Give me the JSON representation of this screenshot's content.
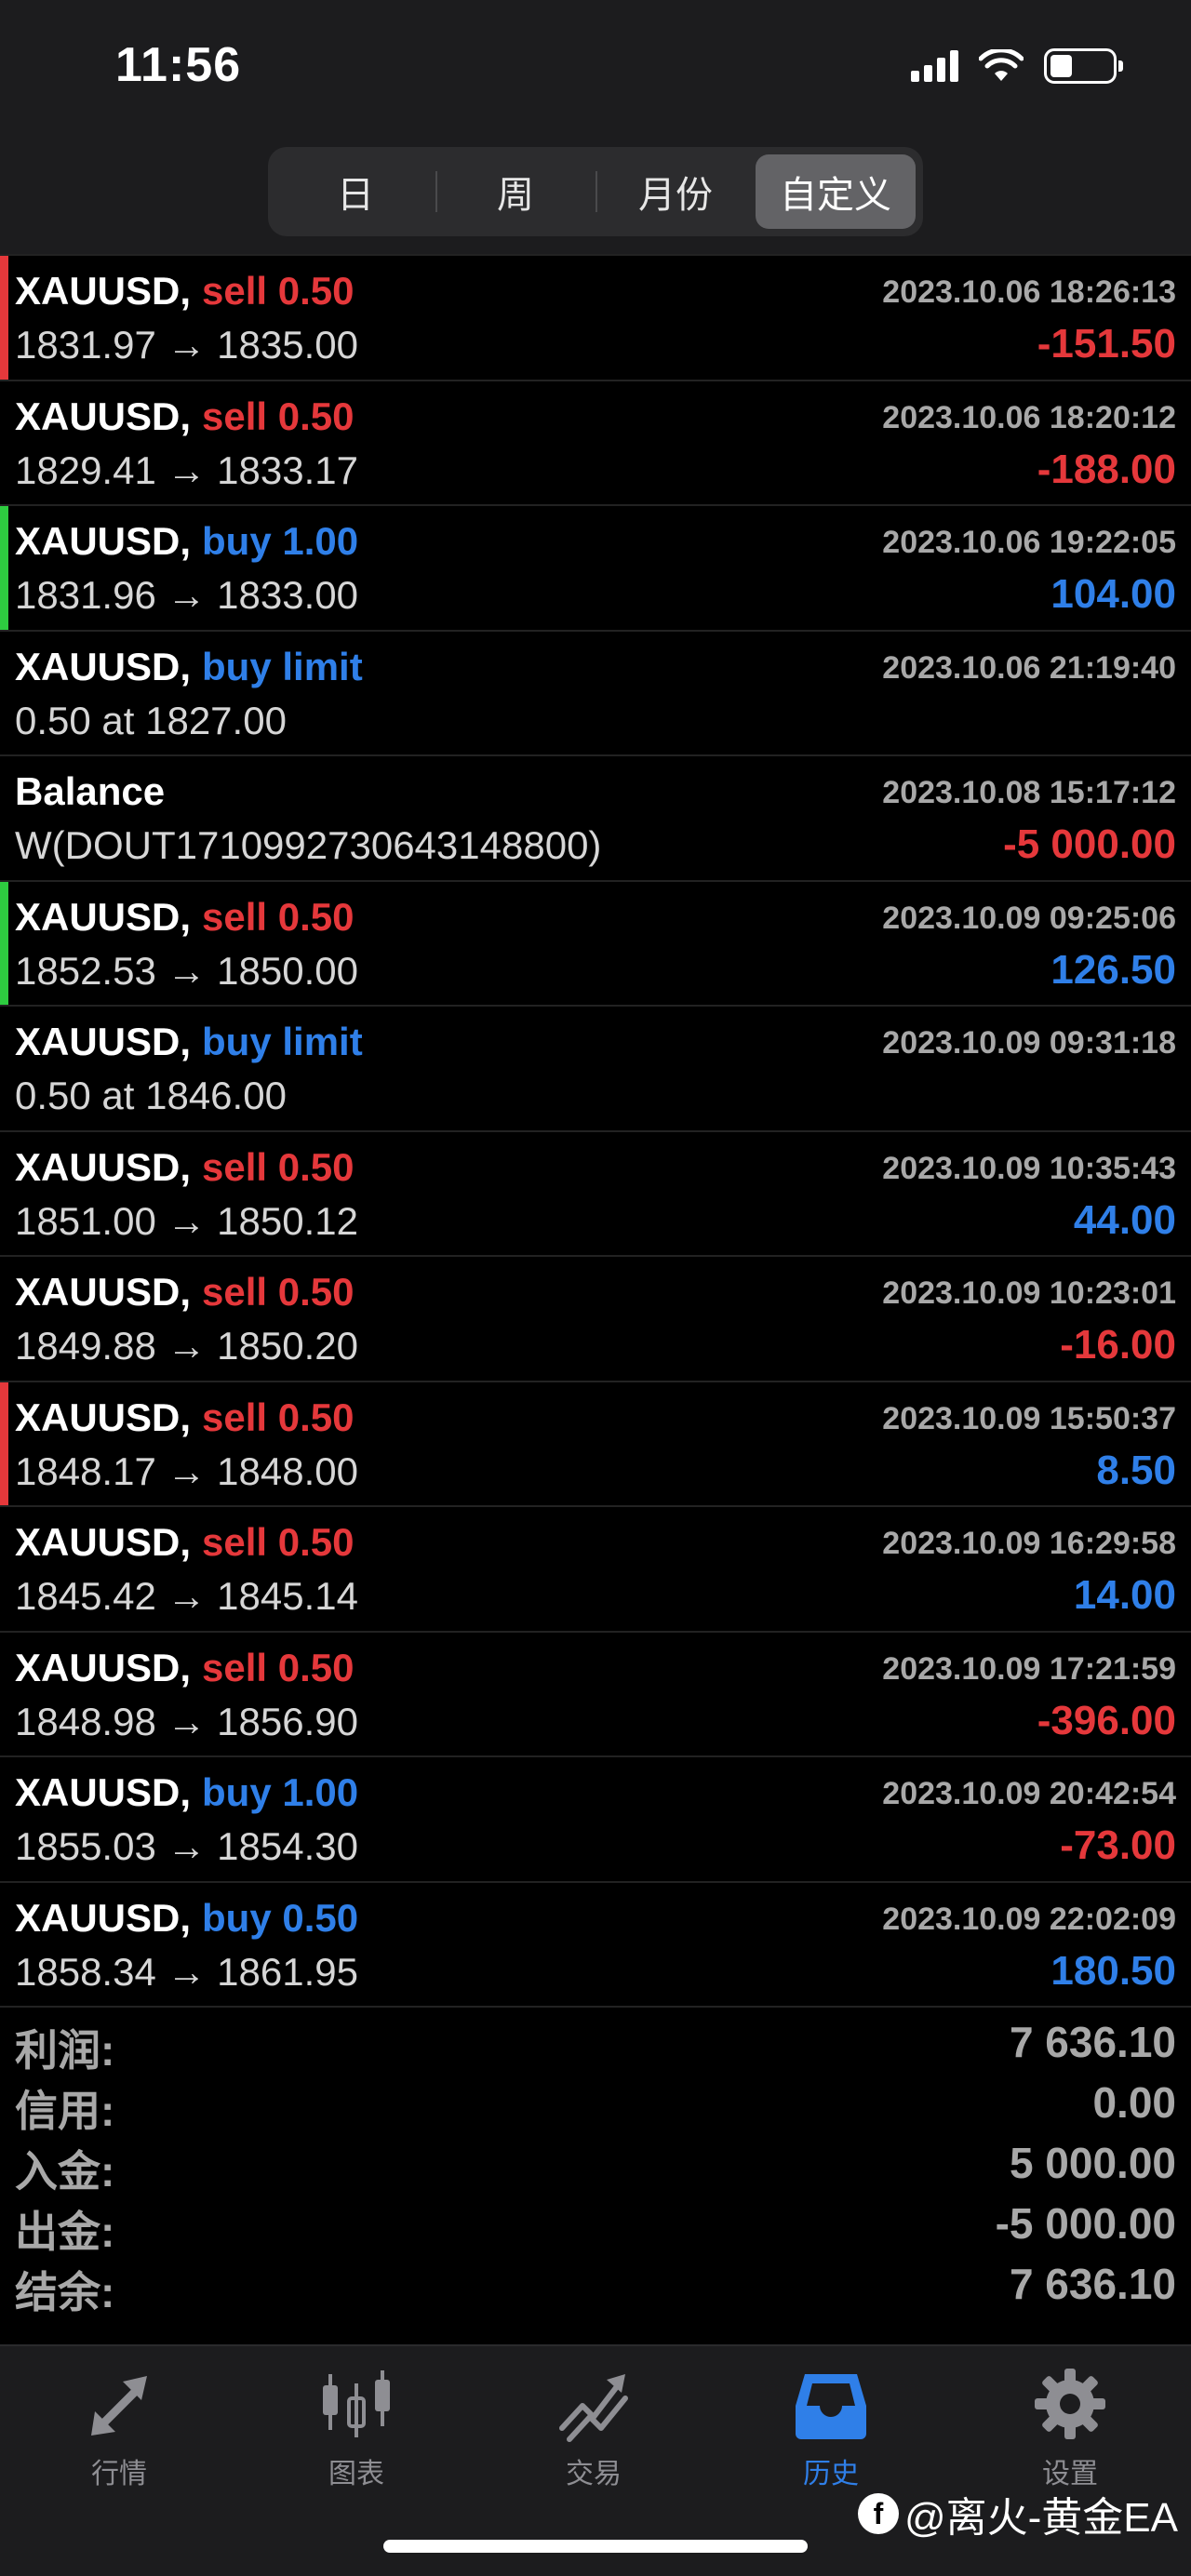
{
  "status": {
    "time": "11:56"
  },
  "segments": [
    {
      "label": "日",
      "active": false
    },
    {
      "label": "周",
      "active": false
    },
    {
      "label": "月份",
      "active": false
    },
    {
      "label": "自定义",
      "active": true
    }
  ],
  "colors": {
    "red": "#e5383b",
    "blue": "#2f7fe8",
    "green": "#2ecc40"
  },
  "rows": [
    {
      "sym": "XAUUSD,",
      "side": "sell 0.50",
      "side_color": "red",
      "line2": "1831.97 → 1835.00",
      "time": "2023.10.06 18:26:13",
      "profit": "-151.50",
      "profit_color": "red",
      "mark": "red"
    },
    {
      "sym": "XAUUSD,",
      "side": "sell 0.50",
      "side_color": "red",
      "line2": "1829.41 → 1833.17",
      "time": "2023.10.06 18:20:12",
      "profit": "-188.00",
      "profit_color": "red",
      "mark": ""
    },
    {
      "sym": "XAUUSD,",
      "side": "buy 1.00",
      "side_color": "blue",
      "line2": "1831.96 → 1833.00",
      "time": "2023.10.06 19:22:05",
      "profit": "104.00",
      "profit_color": "blue",
      "mark": "green"
    },
    {
      "sym": "XAUUSD,",
      "side": "buy limit",
      "side_color": "blue",
      "line2": "0.50 at 1827.00",
      "time": "2023.10.06 21:19:40",
      "profit": "",
      "profit_color": "blue",
      "mark": ""
    },
    {
      "sym": "Balance",
      "side": "",
      "side_color": "blue",
      "line2": "W(DOUT1710992730643148800)",
      "time": "2023.10.08 15:17:12",
      "profit": "-5 000.00",
      "profit_color": "red",
      "mark": ""
    },
    {
      "sym": "XAUUSD,",
      "side": "sell 0.50",
      "side_color": "red",
      "line2": "1852.53 → 1850.00",
      "time": "2023.10.09 09:25:06",
      "profit": "126.50",
      "profit_color": "blue",
      "mark": "green"
    },
    {
      "sym": "XAUUSD,",
      "side": "buy limit",
      "side_color": "blue",
      "line2": "0.50 at 1846.00",
      "time": "2023.10.09 09:31:18",
      "profit": "",
      "profit_color": "blue",
      "mark": ""
    },
    {
      "sym": "XAUUSD,",
      "side": "sell 0.50",
      "side_color": "red",
      "line2": "1851.00 → 1850.12",
      "time": "2023.10.09 10:35:43",
      "profit": "44.00",
      "profit_color": "blue",
      "mark": ""
    },
    {
      "sym": "XAUUSD,",
      "side": "sell 0.50",
      "side_color": "red",
      "line2": "1849.88 → 1850.20",
      "time": "2023.10.09 10:23:01",
      "profit": "-16.00",
      "profit_color": "red",
      "mark": ""
    },
    {
      "sym": "XAUUSD,",
      "side": "sell 0.50",
      "side_color": "red",
      "line2": "1848.17 → 1848.00",
      "time": "2023.10.09 15:50:37",
      "profit": "8.50",
      "profit_color": "blue",
      "mark": "red"
    },
    {
      "sym": "XAUUSD,",
      "side": "sell 0.50",
      "side_color": "red",
      "line2": "1845.42 → 1845.14",
      "time": "2023.10.09 16:29:58",
      "profit": "14.00",
      "profit_color": "blue",
      "mark": ""
    },
    {
      "sym": "XAUUSD,",
      "side": "sell 0.50",
      "side_color": "red",
      "line2": "1848.98 → 1856.90",
      "time": "2023.10.09 17:21:59",
      "profit": "-396.00",
      "profit_color": "red",
      "mark": ""
    },
    {
      "sym": "XAUUSD,",
      "side": "buy 1.00",
      "side_color": "blue",
      "line2": "1855.03 → 1854.30",
      "time": "2023.10.09 20:42:54",
      "profit": "-73.00",
      "profit_color": "red",
      "mark": ""
    },
    {
      "sym": "XAUUSD,",
      "side": "buy 0.50",
      "side_color": "blue",
      "line2": "1858.34 → 1861.95",
      "time": "2023.10.09 22:02:09",
      "profit": "180.50",
      "profit_color": "blue",
      "mark": ""
    }
  ],
  "summary": [
    {
      "label": "利润:",
      "value": "7 636.10"
    },
    {
      "label": "信用:",
      "value": "0.00"
    },
    {
      "label": "入金:",
      "value": "5 000.00"
    },
    {
      "label": "出金:",
      "value": "-5 000.00"
    },
    {
      "label": "结余:",
      "value": "7 636.10"
    }
  ],
  "tabs": [
    {
      "label": "行情",
      "icon": "quotes-icon",
      "active": false
    },
    {
      "label": "图表",
      "icon": "chart-icon",
      "active": false
    },
    {
      "label": "交易",
      "icon": "trade-icon",
      "active": false
    },
    {
      "label": "历史",
      "icon": "history-icon",
      "active": true
    },
    {
      "label": "设置",
      "icon": "settings-icon",
      "active": false
    }
  ],
  "watermark": {
    "logo": "f",
    "text": "@离火-黄金EA"
  }
}
